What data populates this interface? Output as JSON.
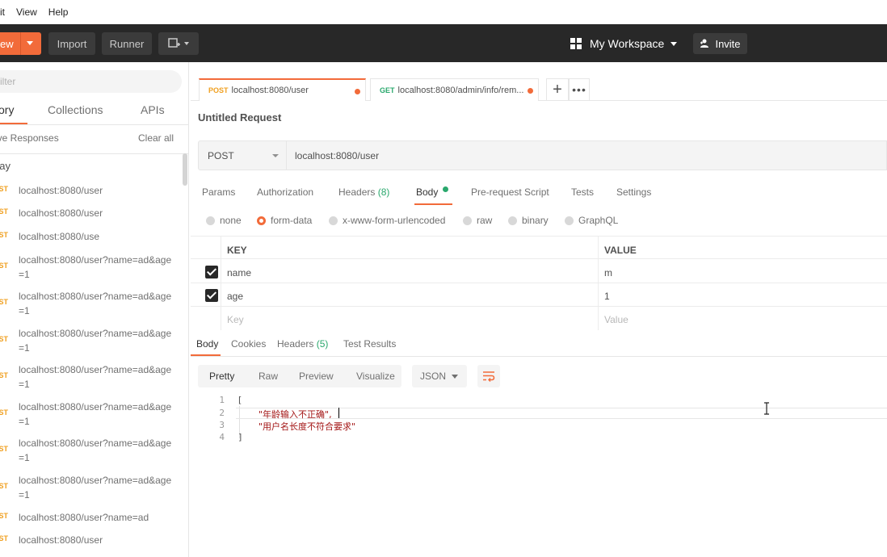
{
  "menu": [
    "it",
    "View",
    "Help"
  ],
  "header": {
    "new_label": "ew",
    "import_label": "Import",
    "runner_label": "Runner",
    "workspace_label": "My Workspace",
    "invite_label": "Invite"
  },
  "sidebar": {
    "filter_placeholder": "ilter",
    "tabs": [
      "ory",
      "Collections",
      "APIs"
    ],
    "save_responses": "ave Responses",
    "clear_all": "Clear all",
    "group_label": "day",
    "items": [
      {
        "method": "ST",
        "url": "localhost:8080/user"
      },
      {
        "method": "ST",
        "url": "localhost:8080/user"
      },
      {
        "method": "ST",
        "url": "localhost:8080/use"
      },
      {
        "method": "ST",
        "url": "localhost:8080/user?name=ad&age=1"
      },
      {
        "method": "ST",
        "url": "localhost:8080/user?name=ad&age=1"
      },
      {
        "method": "ST",
        "url": "localhost:8080/user?name=ad&age=1"
      },
      {
        "method": "ST",
        "url": "localhost:8080/user?name=ad&age=1"
      },
      {
        "method": "ST",
        "url": "localhost:8080/user?name=ad&age=1"
      },
      {
        "method": "ST",
        "url": "localhost:8080/user?name=ad&age=1"
      },
      {
        "method": "ST",
        "url": "localhost:8080/user?name=ad&age=1"
      },
      {
        "method": "ST",
        "url": "localhost:8080/user?name=ad"
      },
      {
        "method": "ST",
        "url": "localhost:8080/user"
      }
    ]
  },
  "tabs": [
    {
      "method": "POST",
      "url": "localhost:8080/user"
    },
    {
      "method": "GET",
      "url": "localhost:8080/admin/info/rem..."
    }
  ],
  "request": {
    "name": "Untitled Request",
    "method": "POST",
    "url": "localhost:8080/user",
    "tabs": {
      "params": "Params",
      "authorization": "Authorization",
      "headers": "Headers",
      "headers_count": "(8)",
      "body": "Body",
      "prerequest": "Pre-request Script",
      "tests": "Tests",
      "settings": "Settings"
    },
    "body_types": [
      "none",
      "form-data",
      "x-www-form-urlencoded",
      "raw",
      "binary",
      "GraphQL"
    ],
    "kv_header": {
      "key": "KEY",
      "value": "VALUE"
    },
    "rows": [
      {
        "key": "name",
        "value": "m"
      },
      {
        "key": "age",
        "value": "1"
      }
    ],
    "placeholder": {
      "key": "Key",
      "value": "Value"
    }
  },
  "response": {
    "tabs": {
      "body": "Body",
      "cookies": "Cookies",
      "headers": "Headers",
      "headers_count": "(5)",
      "test_results": "Test Results"
    },
    "views": [
      "Pretty",
      "Raw",
      "Preview",
      "Visualize"
    ],
    "format": "JSON",
    "lines": [
      {
        "n": "1",
        "text": "["
      },
      {
        "n": "2",
        "text": "\"年龄输入不正确\","
      },
      {
        "n": "3",
        "text": "\"用户名长度不符合要求\""
      },
      {
        "n": "4",
        "text": "]"
      }
    ]
  },
  "colors": {
    "accent": "#f26b3a",
    "header_bg": "#282828",
    "success": "#2aa86d",
    "post": "#f0a020"
  }
}
